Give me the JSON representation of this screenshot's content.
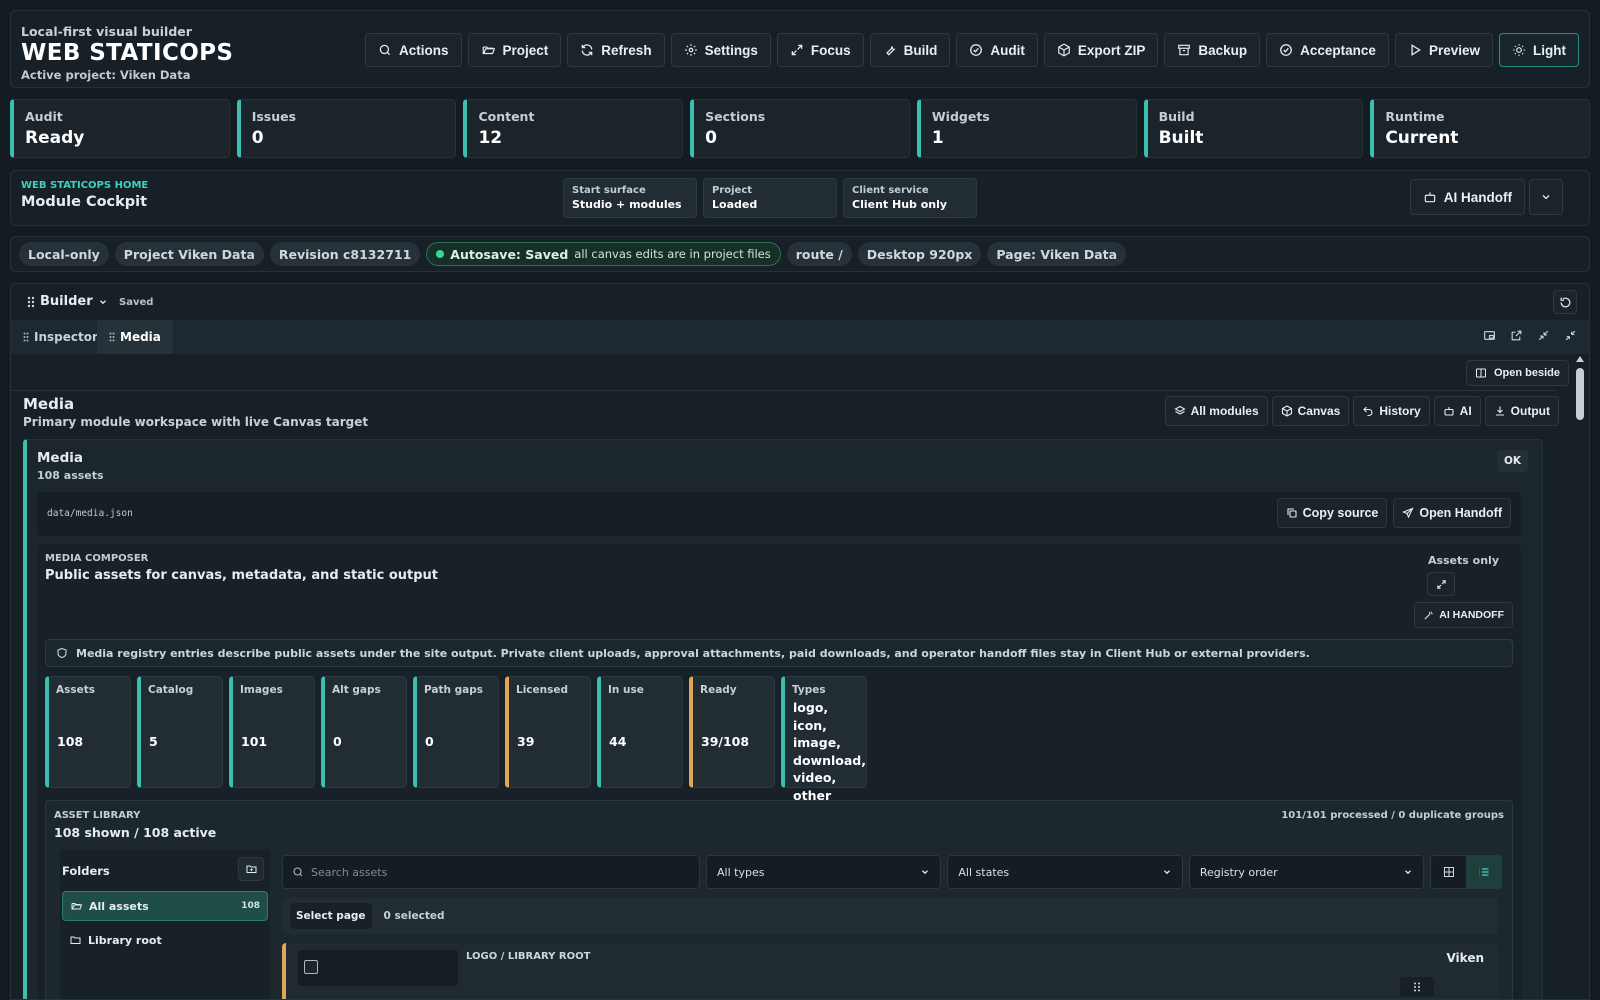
{
  "header": {
    "subtitle": "Local-first visual builder",
    "title": "WEB STATICOPS",
    "active_project": "Active project: Viken Data",
    "actions": [
      {
        "label": "Actions",
        "icon": "search-icon"
      },
      {
        "label": "Project",
        "icon": "folder-open-icon"
      },
      {
        "label": "Refresh",
        "icon": "refresh-icon"
      },
      {
        "label": "Settings",
        "icon": "gear-icon"
      },
      {
        "label": "Focus",
        "icon": "expand-icon"
      },
      {
        "label": "Build",
        "icon": "wrench-icon"
      },
      {
        "label": "Audit",
        "icon": "check-circle-icon"
      },
      {
        "label": "Export ZIP",
        "icon": "package-icon"
      },
      {
        "label": "Backup",
        "icon": "archive-icon"
      },
      {
        "label": "Acceptance",
        "icon": "check-circle-icon"
      },
      {
        "label": "Preview",
        "icon": "play-icon"
      },
      {
        "label": "Light",
        "icon": "sun-icon"
      }
    ]
  },
  "metrics": [
    {
      "label": "Audit",
      "value": "Ready"
    },
    {
      "label": "Issues",
      "value": "0"
    },
    {
      "label": "Content",
      "value": "12"
    },
    {
      "label": "Sections",
      "value": "0"
    },
    {
      "label": "Widgets",
      "value": "1"
    },
    {
      "label": "Build",
      "value": "Built"
    },
    {
      "label": "Runtime",
      "value": "Current"
    }
  ],
  "cockpit": {
    "eyebrow": "WEB STATICOPS HOME",
    "title": "Module Cockpit",
    "cards": [
      {
        "label": "Start surface",
        "value": "Studio + modules"
      },
      {
        "label": "Project",
        "value": "Loaded"
      },
      {
        "label": "Client service",
        "value": "Client Hub only"
      }
    ],
    "ai_handoff": "AI Handoff"
  },
  "chips": {
    "local": "Local-only",
    "project": "Project Viken Data",
    "revision": "Revision c8132711",
    "autosave": "Autosave: Saved",
    "autosave_note": "all canvas edits are in project files",
    "route": "route /",
    "viewport": "Desktop 920px",
    "page": "Page: Viken Data"
  },
  "builder": {
    "title": "Builder",
    "status": "Saved",
    "tabs": [
      "Inspector",
      "Media"
    ],
    "active_tab": "Media",
    "open_beside": "Open beside"
  },
  "module": {
    "title": "Media",
    "subtitle": "Primary module workspace with live Canvas target",
    "actions": [
      {
        "label": "All modules",
        "icon": "layers-icon"
      },
      {
        "label": "Canvas",
        "icon": "cube-icon"
      },
      {
        "label": "History",
        "icon": "undo-icon"
      },
      {
        "label": "AI",
        "icon": "robot-icon"
      },
      {
        "label": "Output",
        "icon": "download-icon"
      }
    ]
  },
  "media_panel": {
    "title": "Media",
    "count": "108 assets",
    "status": "OK",
    "source_path": "data/media.json",
    "copy_source": "Copy source",
    "open_handoff": "Open Handoff"
  },
  "composer": {
    "eyebrow": "MEDIA COMPOSER",
    "title": "Public assets for canvas, metadata, and static output",
    "mode": "Assets only",
    "ai_handoff": "AI HANDOFF",
    "notice": "Media registry entries describe public assets under the site output. Private client uploads, approval attachments, paid downloads, and operator handoff files stay in Client Hub or external providers.",
    "stats": [
      {
        "label": "Assets",
        "value": "108",
        "tone": "ok"
      },
      {
        "label": "Catalog",
        "value": "5",
        "tone": "ok"
      },
      {
        "label": "Images",
        "value": "101",
        "tone": "ok"
      },
      {
        "label": "Alt gaps",
        "value": "0",
        "tone": "ok"
      },
      {
        "label": "Path gaps",
        "value": "0",
        "tone": "ok"
      },
      {
        "label": "Licensed",
        "value": "39",
        "tone": "warn"
      },
      {
        "label": "In use",
        "value": "44",
        "tone": "ok"
      },
      {
        "label": "Ready",
        "value": "39/108",
        "tone": "warn"
      },
      {
        "label": "Types",
        "value": "logo, icon, image, download, video, other",
        "tone": "ok"
      }
    ]
  },
  "library": {
    "eyebrow": "ASSET LIBRARY",
    "title": "108 shown / 108 active",
    "processed": "101/101 processed / 0 duplicate groups",
    "folders_title": "Folders",
    "folders": [
      {
        "label": "All assets",
        "count": "108"
      },
      {
        "label": "Library root",
        "count": ""
      }
    ],
    "search_placeholder": "Search assets",
    "type_filter": "All types",
    "state_filter": "All states",
    "sort": "Registry order",
    "select_page": "Select page",
    "selected_count": "0 selected",
    "row": {
      "category": "LOGO / LIBRARY ROOT",
      "name": "Viken"
    }
  },
  "colors": {
    "accent": "#3bbfb1",
    "warning": "#e2a65a",
    "background": "#141b21",
    "panel": "#172027"
  }
}
